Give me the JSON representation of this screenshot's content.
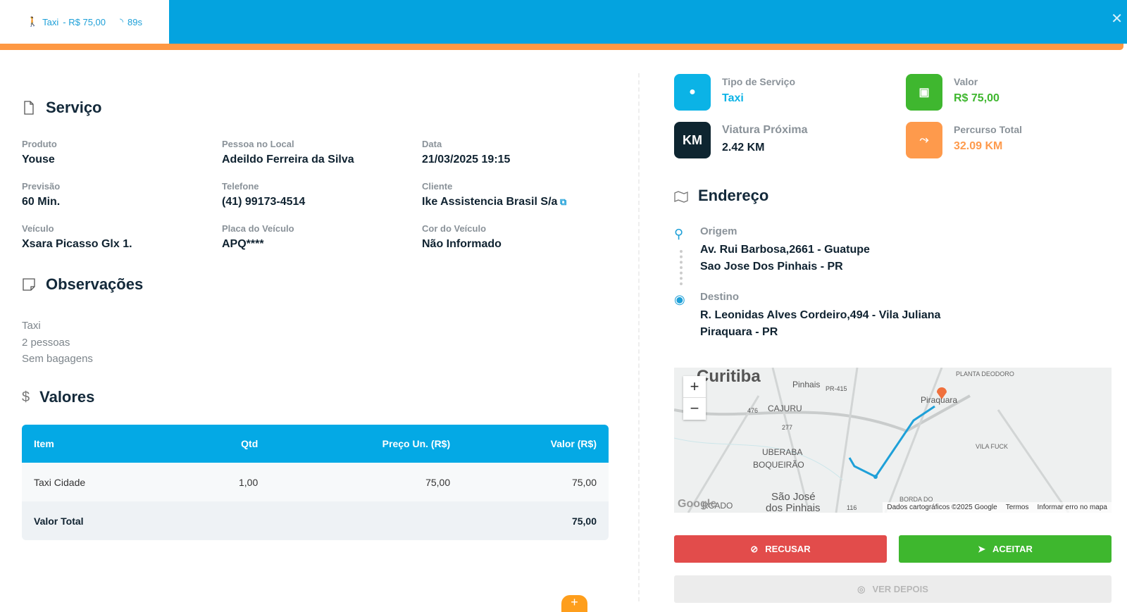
{
  "header": {
    "service": "Taxi",
    "price": "- R$ 75,00",
    "timer": "89s"
  },
  "servico": {
    "title": "Serviço",
    "fields": [
      {
        "label": "Produto",
        "value": "Youse"
      },
      {
        "label": "Pessoa no Local",
        "value": "Adeildo Ferreira da Silva"
      },
      {
        "label": "Data",
        "value": "21/03/2025 19:15"
      },
      {
        "label": "Previsão",
        "value": "60 Min."
      },
      {
        "label": "Telefone",
        "value": "(41) 99173-4514"
      },
      {
        "label": "Cliente",
        "value": "Ike Assistencia Brasil S/a"
      },
      {
        "label": "Veículo",
        "value": "Xsara Picasso Glx 1."
      },
      {
        "label": "Placa do Veículo",
        "value": "APQ****"
      },
      {
        "label": "Cor do Veículo",
        "value": "Não Informado"
      }
    ]
  },
  "observacoes": {
    "title": "Observações",
    "lines": [
      "Taxi",
      "2 pessoas",
      "Sem bagagens"
    ]
  },
  "valores": {
    "title": "Valores",
    "headers": [
      "Item",
      "Qtd",
      "Preço Un. (R$)",
      "Valor (R$)"
    ],
    "rows": [
      [
        "Taxi Cidade",
        "1,00",
        "75,00",
        "75,00"
      ]
    ],
    "total_label": "Valor Total",
    "total": "75,00"
  },
  "cards": [
    {
      "label": "Tipo de Serviço",
      "value": "Taxi",
      "color": "#0bb3e6"
    },
    {
      "label": "Valor",
      "value": "R$ 75,00",
      "color": "#3fb72f"
    },
    {
      "label": "Viatura Próxima",
      "value": "2.42 KM",
      "icon_text": "KM",
      "color": "#0e2530"
    },
    {
      "label": "Percurso Total",
      "value": "32.09 KM",
      "color": "#fe9a4c"
    }
  ],
  "endereco": {
    "title": "Endereço",
    "origem_label": "Origem",
    "origem": [
      "Av. Rui Barbosa,2661 - Guatupe",
      "Sao Jose Dos Pinhais - PR"
    ],
    "destino_label": "Destino",
    "destino": [
      "R. Leonidas Alves Cordeiro,494 - Vila Juliana",
      "Piraquara - PR"
    ]
  },
  "map": {
    "labels": [
      "Curitiba",
      "Pinhais",
      "PR-415",
      "PLANTA DEODORO",
      "Piraquara",
      "CAJURU",
      "476",
      "277",
      "UBERABA",
      "BOQUEIRÃO",
      "VILA FUCK",
      "São José",
      "dos Pinhais",
      "BORDA DO",
      "RCADO",
      "116"
    ],
    "zoom_in": "+",
    "zoom_out": "−",
    "attribution": "Dados cartográficos ©2025 Google",
    "terms": "Termos",
    "report": "Informar erro no mapa",
    "logo": "Google"
  },
  "actions": {
    "reject": "RECUSAR",
    "accept": "ACEITAR",
    "later": "VER DEPOIS"
  },
  "fab": "+"
}
